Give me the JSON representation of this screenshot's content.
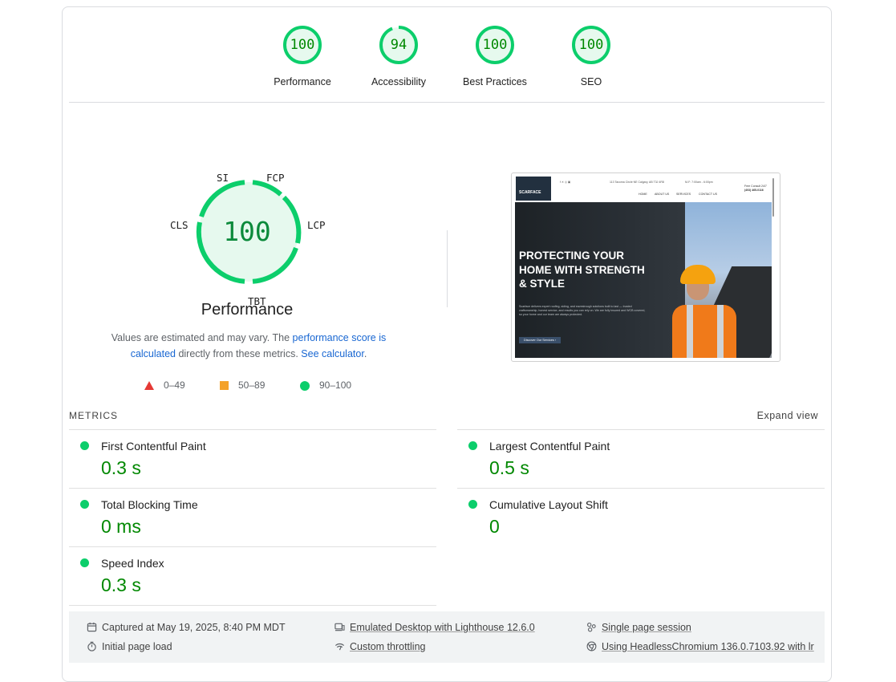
{
  "categories": [
    {
      "label": "Performance",
      "score": "100",
      "fraction": 1.0
    },
    {
      "label": "Accessibility",
      "score": "94",
      "fraction": 0.94
    },
    {
      "label": "Best Practices",
      "score": "100",
      "fraction": 1.0
    },
    {
      "label": "SEO",
      "score": "100",
      "fraction": 1.0
    }
  ],
  "performance": {
    "score": "100",
    "title": "Performance",
    "gauge_labels": {
      "si": "SI",
      "fcp": "FCP",
      "lcp": "LCP",
      "tbt": "TBT",
      "cls": "CLS"
    },
    "note_prefix": "Values are estimated and may vary. The ",
    "note_link1": "performance score is calculated",
    "note_middle": " directly from these metrics. ",
    "note_link2": "See calculator",
    "note_suffix": "."
  },
  "legend": [
    {
      "range": "0–49",
      "shape": "triangle",
      "color": "#e53935"
    },
    {
      "range": "50–89",
      "shape": "square",
      "color": "#f4a22a"
    },
    {
      "range": "90–100",
      "shape": "circle",
      "color": "#0cce6b"
    }
  ],
  "screenshot": {
    "logo": "SCARFACE",
    "address": "113 Tacoma Circle NE Calgary, AB T3J 4R8",
    "hours": "M-F: 7:00am - 6:00pm",
    "phone_label": "Free Consult 24/7",
    "phone": "(403) 465-0116",
    "nav": [
      "HOME",
      "ABOUT US",
      "SERVICES",
      "CONTACT US"
    ],
    "headline": "PROTECTING YOUR HOME WITH STRENGTH & STYLE",
    "copy": "Scarface delivers expert roofing, siding, and eavestrough solutions built to last — trusted craftsmanship, honest service, and results you can rely on. We are fully insured and WCB covered, so your home and our team are always protected.",
    "button": "Discover Our Services"
  },
  "metrics": {
    "title": "METRICS",
    "expand": "Expand view",
    "items": [
      {
        "name": "First Contentful Paint",
        "value": "0.3 s"
      },
      {
        "name": "Largest Contentful Paint",
        "value": "0.5 s"
      },
      {
        "name": "Total Blocking Time",
        "value": "0 ms"
      },
      {
        "name": "Cumulative Layout Shift",
        "value": "0"
      },
      {
        "name": "Speed Index",
        "value": "0.3 s"
      }
    ]
  },
  "footer": {
    "captured": "Captured at May 19, 2025, 8:40 PM MDT",
    "initial": "Initial page load",
    "emulated": "Emulated Desktop with Lighthouse 12.6.0",
    "throttling": "Custom throttling",
    "session": "Single page session",
    "browser": "Using HeadlessChromium 136.0.7103.92 with lr"
  },
  "colors": {
    "pass": "#0cce6b",
    "pass_text": "#008800",
    "link": "#1967d2"
  },
  "icons": [
    "calendar-icon",
    "stopwatch-icon",
    "desktop-icon",
    "wifi-throttle-icon",
    "session-icon",
    "chrome-icon"
  ]
}
